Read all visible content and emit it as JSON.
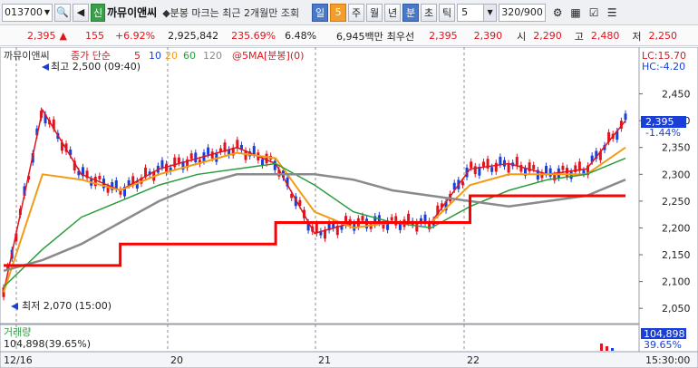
{
  "toolbar": {
    "code": "013700",
    "badge": "신",
    "name": "까뮤이앤씨",
    "note": "◆분봉 마크는 최근 2개월만 조회",
    "periods": [
      "일",
      "주",
      "월",
      "년",
      "분",
      "초",
      "틱"
    ],
    "period_value": "5",
    "interval_value": "5",
    "count": "320/900"
  },
  "infobar": {
    "price": "2,395",
    "change": "155",
    "change_pct": "+6.92%",
    "volume": "2,925,842",
    "volume_ratio": "235.69%",
    "turnover": "6.48%",
    "amount": "6,945백만",
    "best_ask_label": "최우선",
    "best_ask": "2,395",
    "best_bid": "2,390",
    "open_label": "시",
    "open": "2,290",
    "high_label": "고",
    "high": "2,480",
    "low_label": "저",
    "low": "2,250"
  },
  "chart": {
    "title": "까뮤이앤씨",
    "ma_label": "종가 단순",
    "ma_periods": [
      "5",
      "10",
      "20",
      "60",
      "120"
    ],
    "indicator_label": "@5MA[분봉](0)",
    "high_mark": "최고 2,500 (09:40)",
    "low_mark": "최저 2,070 (15:00)",
    "lc": "LC:15.70",
    "hc": "HC:-4.20",
    "price_ticks": [
      "2,450",
      "2,400",
      "2,350",
      "2,300",
      "2,250",
      "2,200",
      "2,150",
      "2,100",
      "2,050"
    ],
    "current_price": "2,395",
    "current_pct": "-1.44%",
    "volume_title": "거래량",
    "volume_value": "104,898(39.65%)",
    "volume_box": "104,898",
    "volume_pct": "39.65%",
    "x_labels": [
      "12/16",
      "20",
      "21",
      "22"
    ],
    "time_label": "15:30:00"
  },
  "chart_data": {
    "type": "line",
    "title": "까뮤이앤씨",
    "ylim": [
      2030,
      2500
    ],
    "yticks": [
      2450,
      2400,
      2350,
      2300,
      2250,
      2200,
      2150,
      2100,
      2050
    ],
    "categories": [
      "12/16",
      "20",
      "21",
      "22"
    ],
    "series": [
      {
        "name": "5",
        "values": [
          2080,
          2420,
          2300,
          2270,
          2310,
          2330,
          2350,
          2320,
          2190,
          2210,
          2210,
          2210,
          2310,
          2320,
          2300,
          2310,
          2400
        ]
      },
      {
        "name": "20",
        "values": [
          2080,
          2300,
          2290,
          2270,
          2300,
          2320,
          2340,
          2330,
          2230,
          2200,
          2210,
          2210,
          2280,
          2300,
          2300,
          2300,
          2350
        ]
      },
      {
        "name": "60",
        "values": [
          2090,
          2160,
          2220,
          2250,
          2280,
          2300,
          2310,
          2320,
          2280,
          2230,
          2210,
          2200,
          2240,
          2270,
          2290,
          2300,
          2330
        ]
      },
      {
        "name": "120",
        "values": [
          2120,
          2140,
          2170,
          2210,
          2250,
          2280,
          2300,
          2300,
          2300,
          2290,
          2270,
          2260,
          2250,
          2240,
          2250,
          2260,
          2290
        ]
      }
    ],
    "indicator_steps": [
      2130,
      2130,
      2130,
      2170,
      2170,
      2170,
      2170,
      2210,
      2210,
      2210,
      2210,
      2210,
      2260,
      2260,
      2260,
      2260,
      2260
    ],
    "annotations": {
      "high": 2500,
      "low": 2070,
      "last": 2395
    }
  }
}
